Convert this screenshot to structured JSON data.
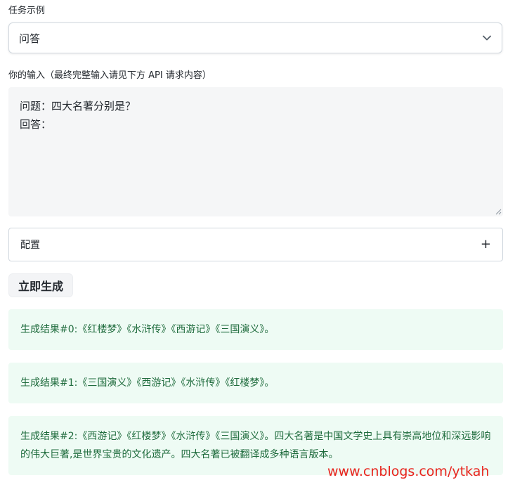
{
  "task": {
    "label": "任务示例",
    "selected": "问答",
    "chevron_icon": "chevron-down-icon"
  },
  "input": {
    "label": "你的输入（最终完整输入请见下方 API 请求内容）",
    "value": "问题：四大名著分别是？\n回答："
  },
  "config": {
    "title": "配置",
    "toggle": "+"
  },
  "generate_button": "立即生成",
  "results": [
    "生成结果#0:《红楼梦》《水浒传》《西游记》《三国演义》。",
    "生成结果#1:《三国演义》《西游记》《水浒传》《红楼梦》。",
    "生成结果#2:《西游记》《红楼梦》《水浒传》《三国演义》。四大名著是中国文学史上具有崇高地位和深远影响的伟大巨著,是世界宝贵的文化遗产。四大名著已被翻译成多种语言版本。"
  ],
  "watermark": "www.cnblogs.com/ytkah"
}
